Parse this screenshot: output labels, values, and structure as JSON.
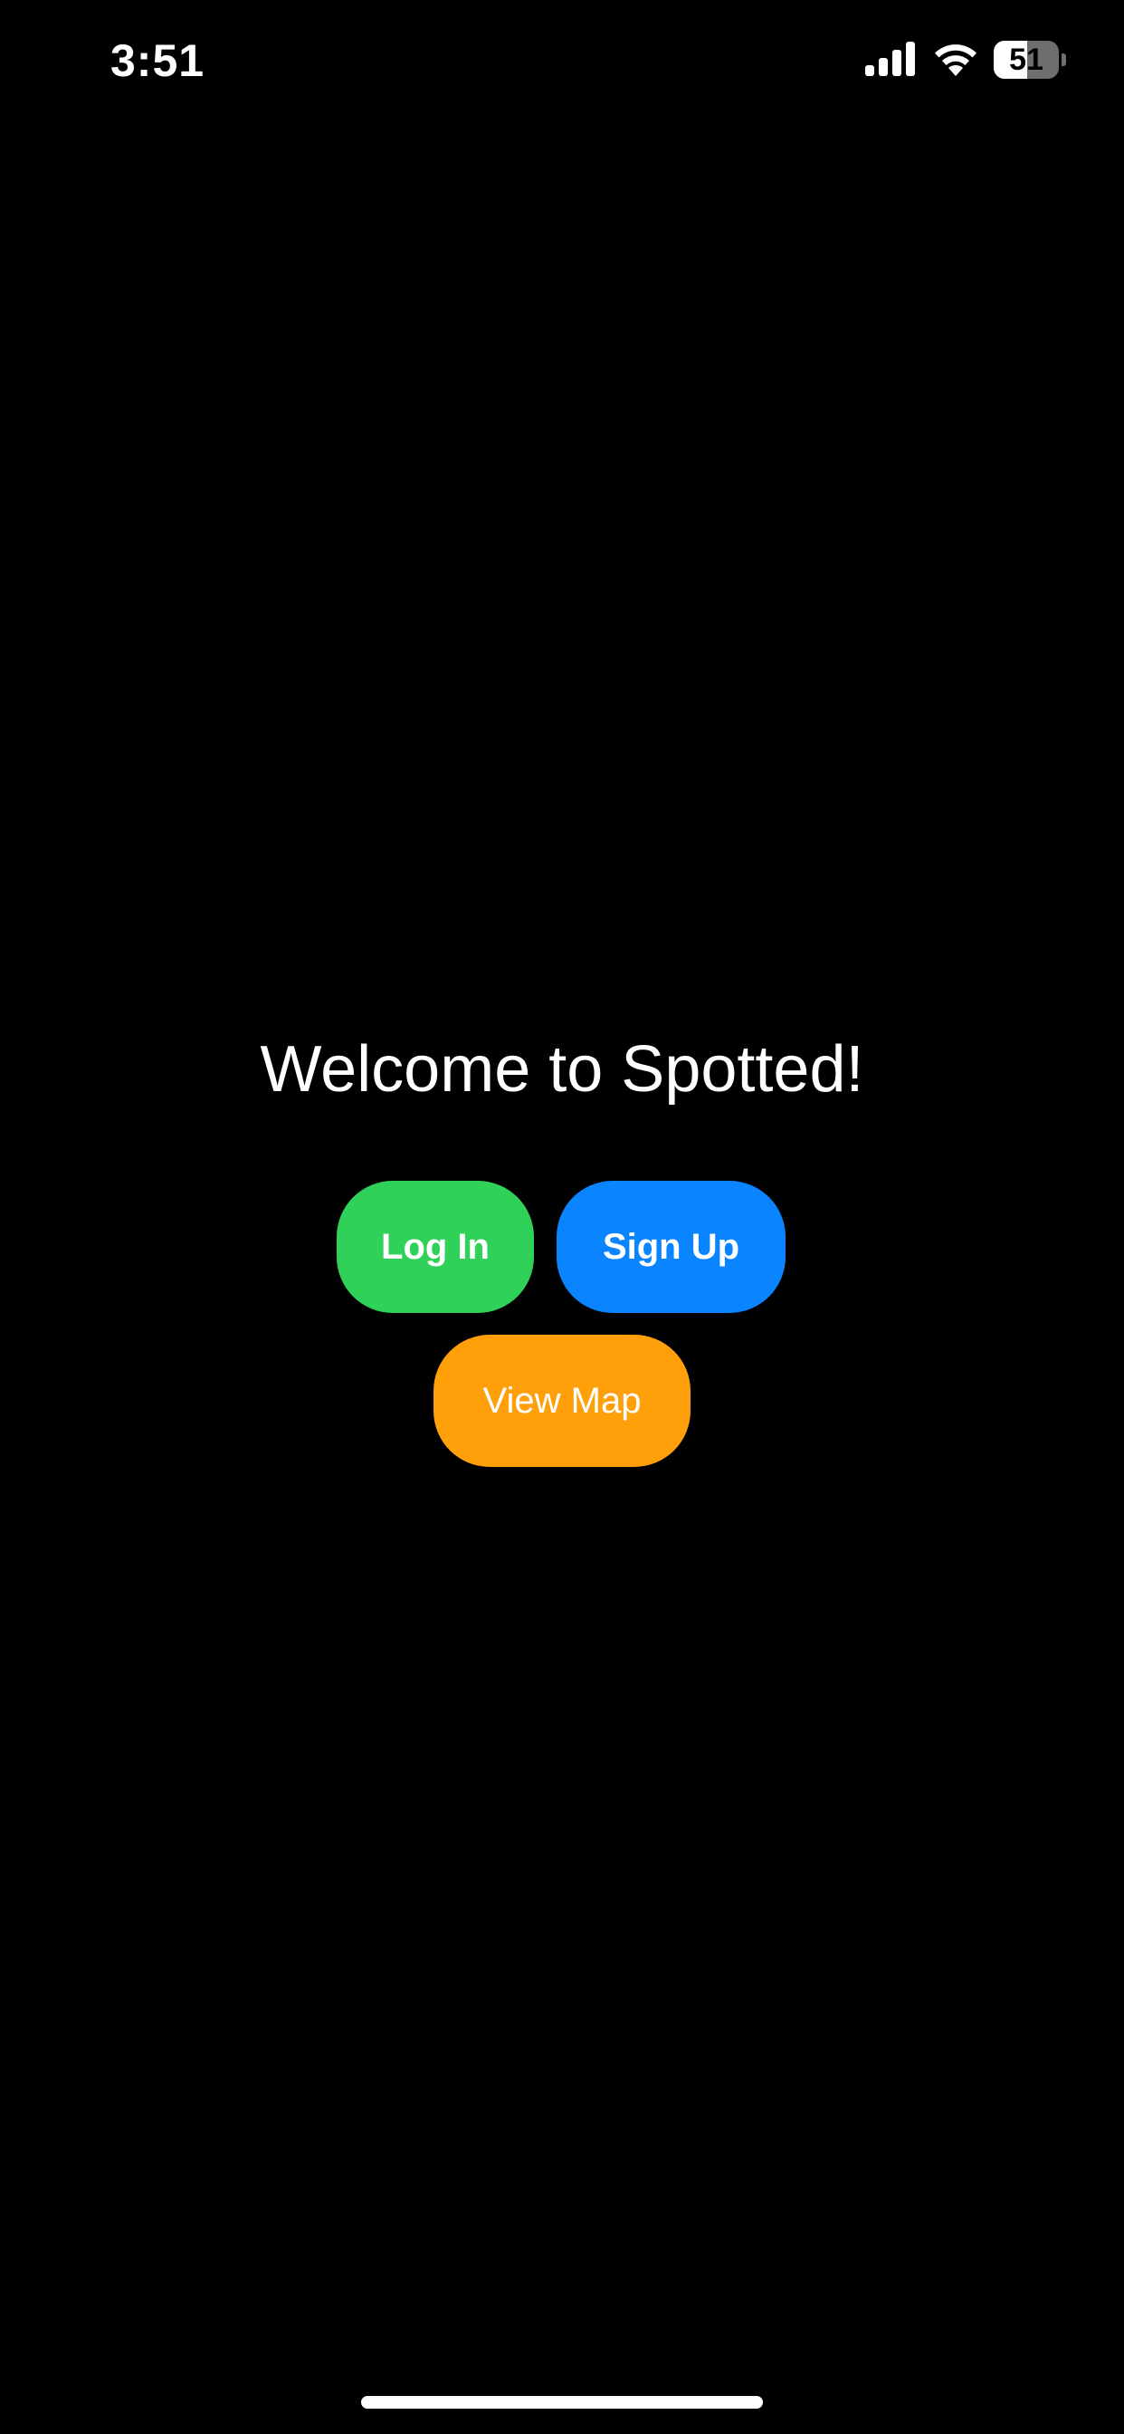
{
  "status_bar": {
    "time": "3:51",
    "battery_level": "51",
    "battery_fraction": 0.51,
    "signal_bars": 4,
    "icons": [
      "signal-icon",
      "wifi-icon",
      "battery-icon"
    ]
  },
  "main": {
    "title": "Welcome to Spotted!",
    "login_label": "Log In",
    "signup_label": "Sign Up",
    "map_label": "View Map"
  },
  "colors": {
    "background": "#000000",
    "login": "#30d158",
    "signup": "#0a84ff",
    "map": "#ff9f0a",
    "text": "#ffffff"
  }
}
